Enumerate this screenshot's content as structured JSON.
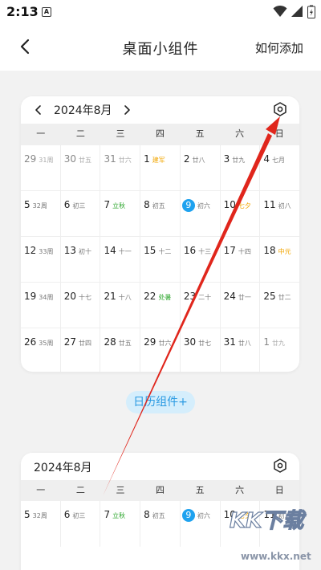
{
  "status": {
    "time": "2:13",
    "app_badge": "A"
  },
  "header": {
    "title": "桌面小组件",
    "action": "如何添加"
  },
  "weekdays": [
    "一",
    "二",
    "三",
    "四",
    "五",
    "六",
    "日"
  ],
  "widget1": {
    "month": "2024年8月",
    "rows": [
      [
        {
          "d": "29",
          "s": "31周",
          "dim": true
        },
        {
          "d": "30",
          "s": "廿五",
          "dim": true
        },
        {
          "d": "31",
          "s": "廿六",
          "dim": true
        },
        {
          "d": "1",
          "s": "建军",
          "hl": "orange"
        },
        {
          "d": "2",
          "s": "廿八"
        },
        {
          "d": "3",
          "s": "廿九"
        },
        {
          "d": "4",
          "s": "七月"
        }
      ],
      [
        {
          "d": "5",
          "s": "32周"
        },
        {
          "d": "6",
          "s": "初三"
        },
        {
          "d": "7",
          "s": "立秋",
          "hl": "green"
        },
        {
          "d": "8",
          "s": "初五"
        },
        {
          "d": "9",
          "s": "初六",
          "today": true
        },
        {
          "d": "10",
          "s": "七夕",
          "hl": "orange"
        },
        {
          "d": "11",
          "s": "初八"
        }
      ],
      [
        {
          "d": "12",
          "s": "33周"
        },
        {
          "d": "13",
          "s": "初十"
        },
        {
          "d": "14",
          "s": "十一"
        },
        {
          "d": "15",
          "s": "十二"
        },
        {
          "d": "16",
          "s": "十三"
        },
        {
          "d": "17",
          "s": "十四"
        },
        {
          "d": "18",
          "s": "中元",
          "hl": "orange"
        }
      ],
      [
        {
          "d": "19",
          "s": "34周"
        },
        {
          "d": "20",
          "s": "十七"
        },
        {
          "d": "21",
          "s": "十八"
        },
        {
          "d": "22",
          "s": "处暑",
          "hl": "green"
        },
        {
          "d": "23",
          "s": "二十"
        },
        {
          "d": "24",
          "s": "廿一"
        },
        {
          "d": "25",
          "s": "廿二"
        }
      ],
      [
        {
          "d": "26",
          "s": "35周"
        },
        {
          "d": "27",
          "s": "廿四"
        },
        {
          "d": "28",
          "s": "廿五"
        },
        {
          "d": "29",
          "s": "廿六"
        },
        {
          "d": "30",
          "s": "廿七"
        },
        {
          "d": "31",
          "s": "廿八"
        },
        {
          "d": "1",
          "s": "廿九",
          "dim": true
        }
      ]
    ]
  },
  "add_widget_label": "日历组件+",
  "widget2": {
    "month": "2024年8月",
    "rows": [
      [
        {
          "d": "5",
          "s": "32周"
        },
        {
          "d": "6",
          "s": "初三"
        },
        {
          "d": "7",
          "s": "立秋",
          "hl": "green"
        },
        {
          "d": "8",
          "s": "初五"
        },
        {
          "d": "9",
          "s": "初六",
          "today": true
        },
        {
          "d": "10",
          "s": "七夕",
          "hl": "orange"
        },
        {
          "d": "11",
          "s": "初八"
        }
      ]
    ]
  },
  "watermark": {
    "main": "KK下载",
    "url": "www.kkx.net"
  },
  "colors": {
    "accent": "#1ea2ef",
    "green": "#2aa52a",
    "orange": "#f2a600",
    "arrow": "#e0261c"
  }
}
